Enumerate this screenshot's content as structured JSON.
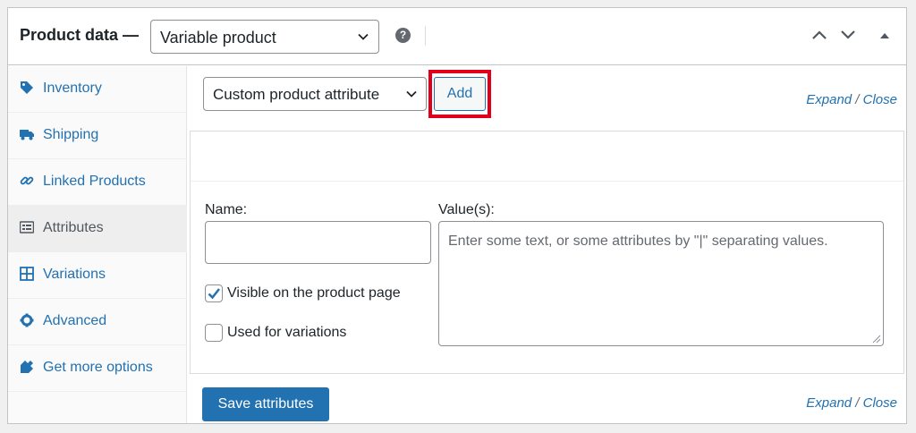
{
  "header": {
    "title": "Product data —",
    "product_type": "Variable product",
    "help_symbol": "?"
  },
  "sidebar": {
    "items": [
      {
        "label": "Inventory",
        "icon": "tag-icon"
      },
      {
        "label": "Shipping",
        "icon": "truck-icon"
      },
      {
        "label": "Linked Products",
        "icon": "link-icon"
      },
      {
        "label": "Attributes",
        "icon": "list-icon",
        "active": true
      },
      {
        "label": "Variations",
        "icon": "grid-icon"
      },
      {
        "label": "Advanced",
        "icon": "gear-icon"
      },
      {
        "label": "Get more options",
        "icon": "plugin-icon"
      }
    ]
  },
  "main": {
    "attribute_select": "Custom product attribute",
    "add_label": "Add",
    "expand_label": "Expand",
    "slash": "/",
    "close_label": "Close",
    "name_label": "Name:",
    "values_label": "Value(s):",
    "name_value": "",
    "values_placeholder": "Enter some text, or some attributes by \"|\" separating values.",
    "visible_label": "Visible on the product page",
    "visible_checked": true,
    "variations_label": "Used for variations",
    "variations_checked": false,
    "save_label": "Save attributes"
  },
  "colors": {
    "accent": "#2271b1",
    "highlight": "#e0001b",
    "active_tab_bg": "#eeeeee"
  }
}
